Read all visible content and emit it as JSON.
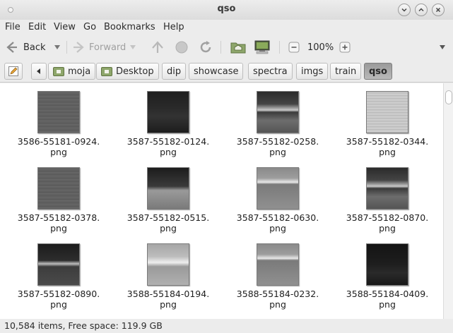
{
  "window": {
    "title": "qso"
  },
  "menu": [
    "File",
    "Edit",
    "View",
    "Go",
    "Bookmarks",
    "Help"
  ],
  "toolbar": {
    "back": "Back",
    "forward": "Forward",
    "zoom": "100%"
  },
  "breadcrumbs": [
    "moja",
    "Desktop",
    "dip",
    "showcase",
    "spectra",
    "imgs",
    "train",
    "qso"
  ],
  "files": [
    {
      "line1": "3586-55181-0924.",
      "line2": "png",
      "style": "gray"
    },
    {
      "line1": "3587-55182-0124.",
      "line2": "png",
      "style": "dark"
    },
    {
      "line1": "3587-55182-0258.",
      "line2": "png",
      "style": "banded"
    },
    {
      "line1": "3587-55182-0344.",
      "line2": "png",
      "style": "light"
    },
    {
      "line1": "3587-55182-0378.",
      "line2": "png",
      "style": "gray"
    },
    {
      "line1": "3587-55182-0515.",
      "line2": "png",
      "style": "darktop"
    },
    {
      "line1": "3587-55182-0630.",
      "line2": "png",
      "style": "banded2"
    },
    {
      "line1": "3587-55182-0870.",
      "line2": "png",
      "style": "banded"
    },
    {
      "line1": "3587-55182-0890.",
      "line2": "png",
      "style": "darkstripe"
    },
    {
      "line1": "3588-55184-0194.",
      "line2": "png",
      "style": "light2"
    },
    {
      "line1": "3588-55184-0232.",
      "line2": "png",
      "style": "banded2"
    },
    {
      "line1": "3588-55184-0409.",
      "line2": "png",
      "style": "verydark"
    }
  ],
  "status": "10,584 items, Free space: 119.9 GB"
}
